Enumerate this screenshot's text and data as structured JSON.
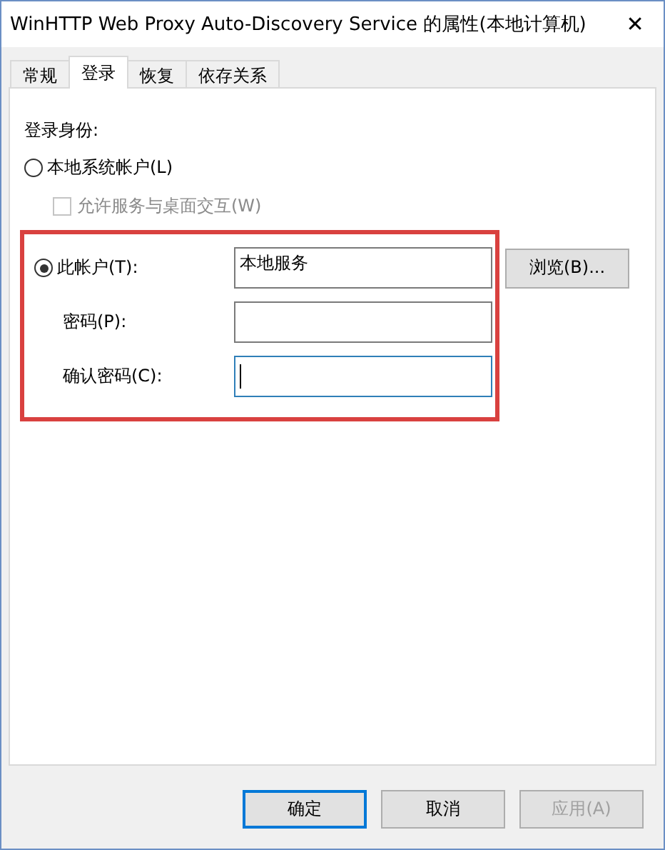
{
  "window": {
    "title": "WinHTTP Web Proxy Auto-Discovery Service 的属性(本地计算机)",
    "close": "✕"
  },
  "tabs": [
    {
      "label": "常规",
      "selected": false
    },
    {
      "label": "登录",
      "selected": true
    },
    {
      "label": "恢复",
      "selected": false
    },
    {
      "label": "依存关系",
      "selected": false
    }
  ],
  "logon": {
    "heading": "登录身份:",
    "local_system": {
      "label": "本地系统帐户(L)",
      "selected": false
    },
    "interact": {
      "label": "允许服务与桌面交互(W)",
      "checked": false,
      "disabled": true
    },
    "this_account": {
      "label": "此帐户(T):",
      "selected": true,
      "value": "本地服务",
      "browse": "浏览(B)..."
    },
    "password": {
      "label": "密码(P):"
    },
    "confirm": {
      "label": "确认密码(C):",
      "focused": true
    }
  },
  "buttons": [
    {
      "label": "确定",
      "default": true,
      "disabled": false
    },
    {
      "label": "取消",
      "default": false,
      "disabled": false
    },
    {
      "label": "应用(A)",
      "default": false,
      "disabled": true
    }
  ]
}
